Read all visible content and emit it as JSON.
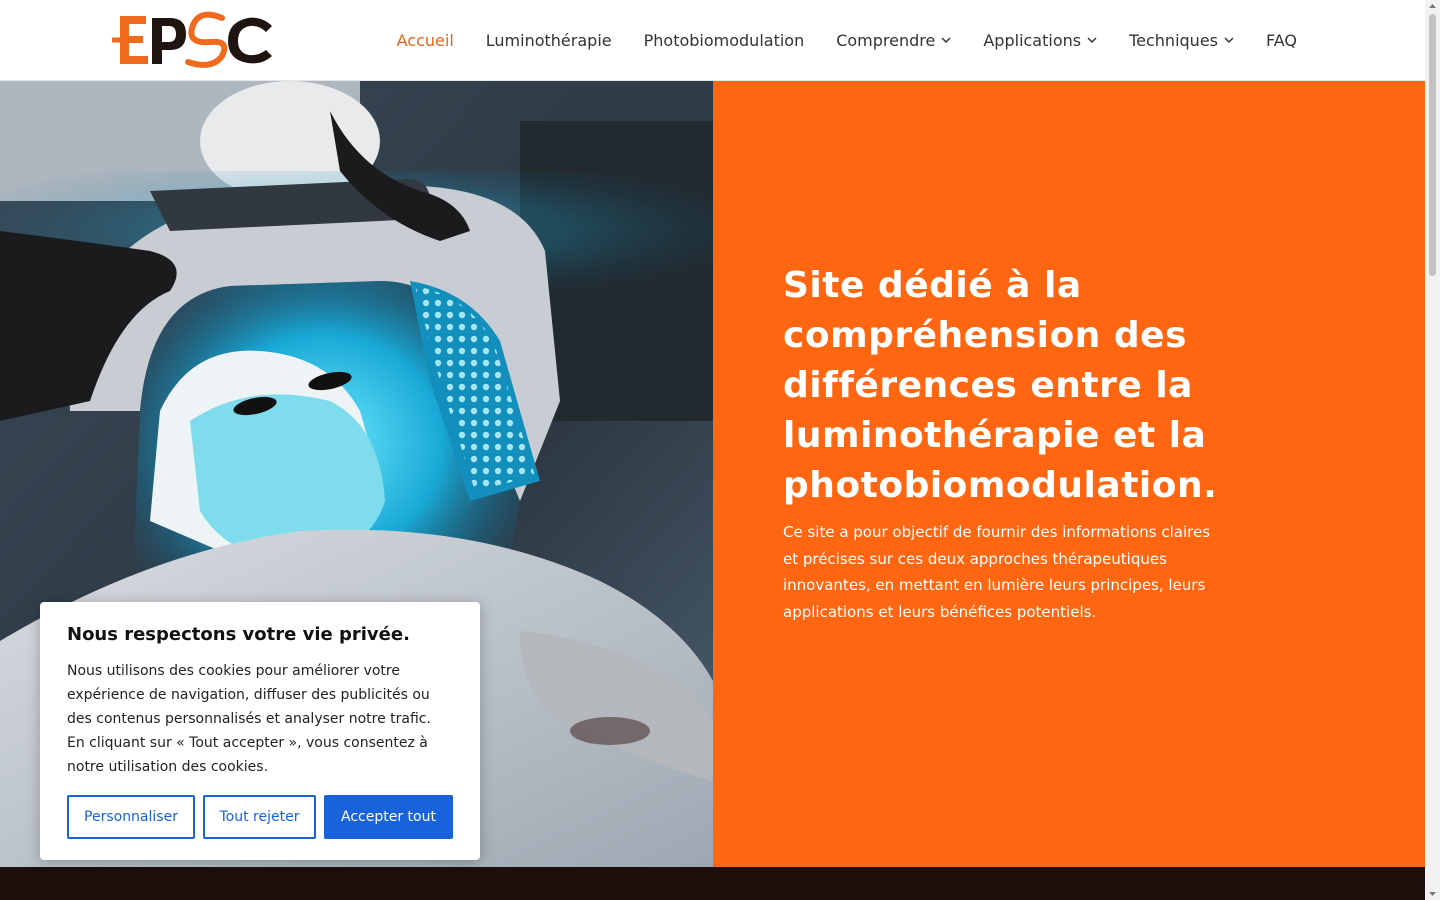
{
  "header": {
    "logo_text": "EPSC",
    "nav": [
      {
        "label": "Accueil",
        "active": true,
        "dropdown": false
      },
      {
        "label": "Luminothérapie",
        "active": false,
        "dropdown": false
      },
      {
        "label": "Photobiomodulation",
        "active": false,
        "dropdown": false
      },
      {
        "label": "Comprendre",
        "active": false,
        "dropdown": true
      },
      {
        "label": "Applications",
        "active": false,
        "dropdown": true
      },
      {
        "label": "Techniques",
        "active": false,
        "dropdown": true
      },
      {
        "label": "FAQ",
        "active": false,
        "dropdown": false
      }
    ]
  },
  "hero": {
    "image_alt": "light-therapy-mask-treatment-photo",
    "title": "Site dédié à la compréhension des différences entre la luminothérapie et la photobiomodulation.",
    "text": "Ce site a pour objectif de fournir des informations claires et précises sur ces deux approches thérapeutiques innovantes, en mettant en lumière leurs principes, leurs applications et leurs bénéfices potentiels."
  },
  "cookie": {
    "title": "Nous respectons votre vie privée.",
    "text": "Nous utilisons des cookies pour améliorer votre expérience de navigation, diffuser des publicités ou des contenus personnalisés et analyser notre trafic. En cliquant sur « Tout accepter », vous consentez à notre utilisation des cookies.",
    "customize_label": "Personnaliser",
    "reject_label": "Tout rejeter",
    "accept_label": "Accepter tout"
  },
  "colors": {
    "accent": "#ff6611",
    "nav_active": "#e8641b",
    "cookie_button": "#1863dc",
    "dark_band": "#1d0f0c"
  },
  "icons": {
    "dropdown": "chevron-down-icon"
  }
}
